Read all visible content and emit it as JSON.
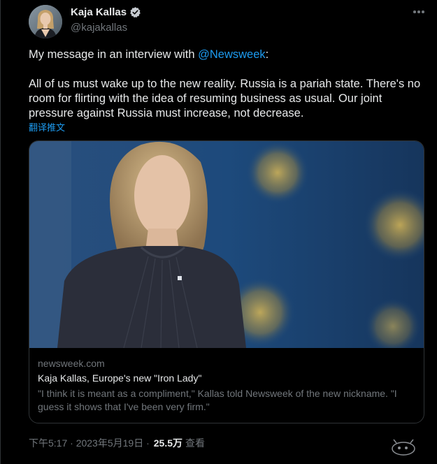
{
  "author": {
    "display_name": "Kaja Kallas",
    "handle": "@kajakallas"
  },
  "icons": {
    "verified": "verified-badge-icon",
    "more": "more-options-icon",
    "watermark": "watermark-logo-icon"
  },
  "tweet": {
    "intro_text": "My message in an interview with ",
    "mention": "@Newsweek",
    "intro_end": ":",
    "body": "All of us must wake up to the new reality. Russia is a pariah state. There's no room for flirting with the idea of resuming business as usual. Our joint pressure against Russia must increase, not decrease.",
    "translate": "翻译推文"
  },
  "card": {
    "domain": "newsweek.com",
    "title": "Kaja Kallas, Europe's new \"Iron Lady\"",
    "description": "\"I think it is meant as a compliment,\" Kallas told Newsweek of the new nickname. \"I guess it shows that I've been very firm.\""
  },
  "meta": {
    "timestamp": "下午5:17 · 2023年5月19日 · ",
    "views_count": "25.5万",
    "views_label": "查看"
  },
  "colors": {
    "background": "#000000",
    "text": "#e7e9ea",
    "secondary_text": "#71767b",
    "link": "#1d9bf0",
    "border": "#2f3336"
  }
}
